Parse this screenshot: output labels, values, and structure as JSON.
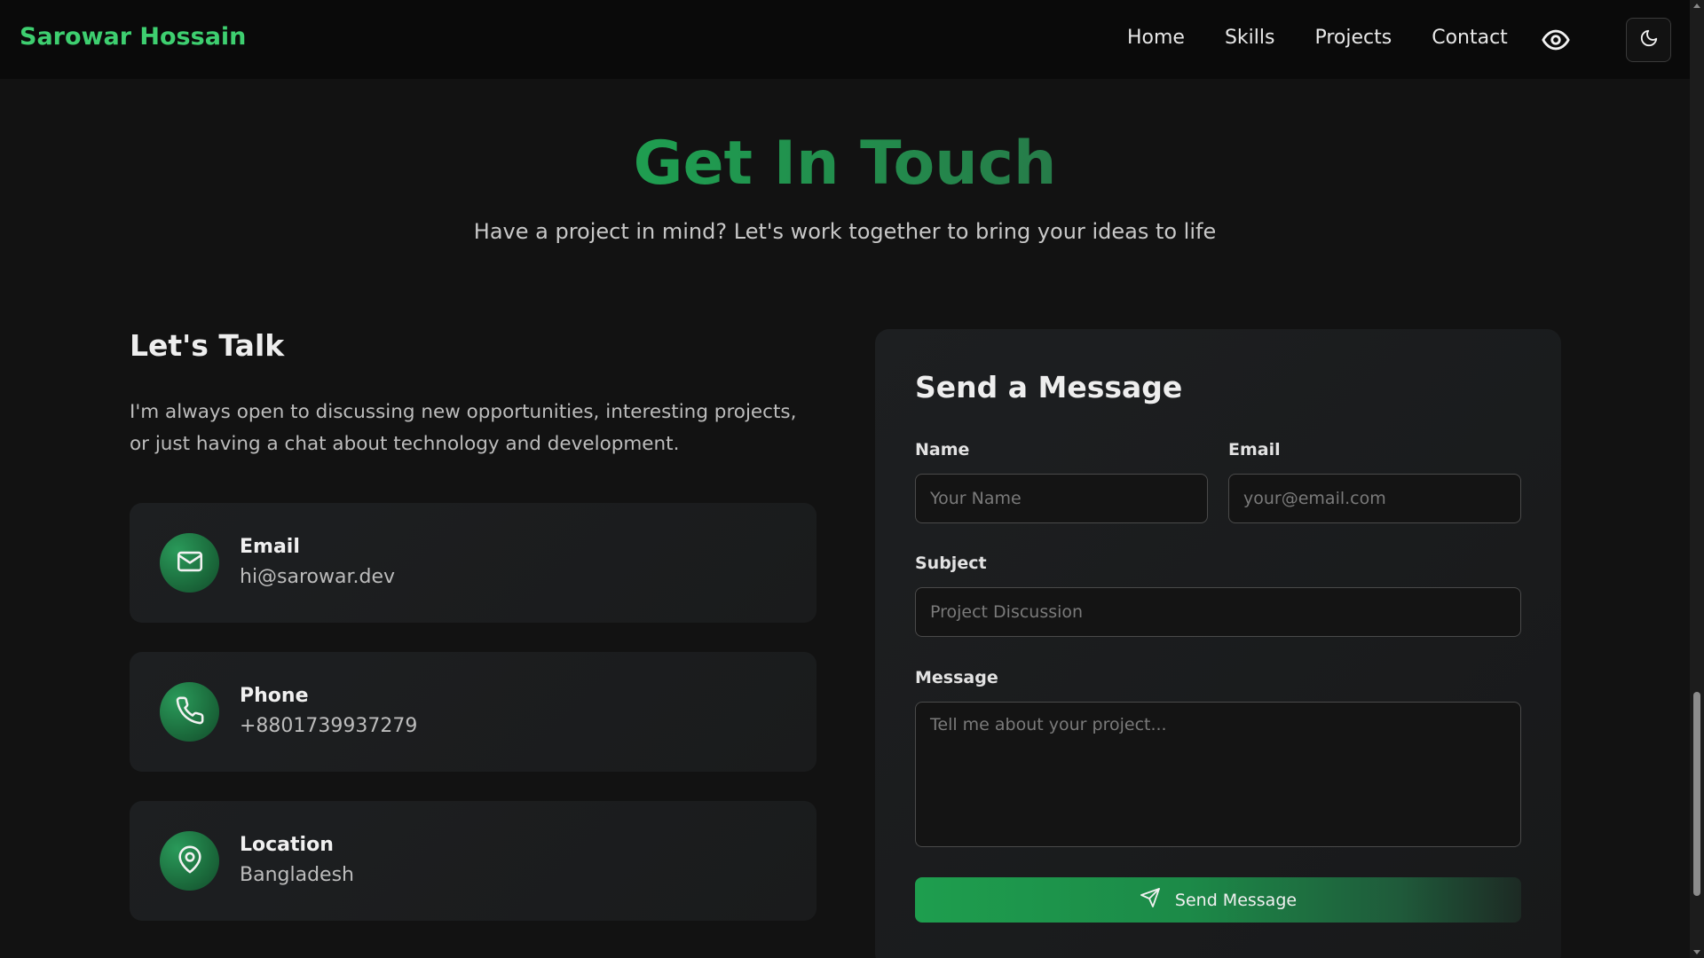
{
  "header": {
    "brand": "Sarowar Hossain",
    "nav": [
      {
        "label": "Home"
      },
      {
        "label": "Skills"
      },
      {
        "label": "Projects"
      },
      {
        "label": "Contact"
      }
    ],
    "icons": {
      "view": "eye-icon",
      "theme": "moon-icon"
    }
  },
  "hero": {
    "title_words": [
      "Get",
      "In",
      "Touch"
    ],
    "subtitle": "Have a project in mind? Let's work together to bring your ideas to life"
  },
  "info": {
    "heading": "Let's Talk",
    "intro": "I'm always open to discussing new opportunities, interesting projects, or just having a chat about technology and development.",
    "cards": [
      {
        "label": "Email",
        "value": "hi@sarowar.dev",
        "icon": "mail-icon"
      },
      {
        "label": "Phone",
        "value": "+8801739937279",
        "icon": "phone-icon"
      },
      {
        "label": "Location",
        "value": "Bangladesh",
        "icon": "map-pin-icon"
      }
    ]
  },
  "form": {
    "title": "Send a Message",
    "name": {
      "label": "Name",
      "placeholder": "Your Name",
      "value": ""
    },
    "email": {
      "label": "Email",
      "placeholder": "your@email.com",
      "value": ""
    },
    "subject": {
      "label": "Subject",
      "placeholder": "Project Discussion",
      "value": ""
    },
    "message": {
      "label": "Message",
      "placeholder": "Tell me about your project...",
      "value": ""
    },
    "submit_label": "Send Message",
    "submit_icon": "send-icon"
  },
  "colors": {
    "accent": "#22b45a",
    "background": "#121212",
    "card": "#1d1f21",
    "header": "#0a0a0a"
  }
}
